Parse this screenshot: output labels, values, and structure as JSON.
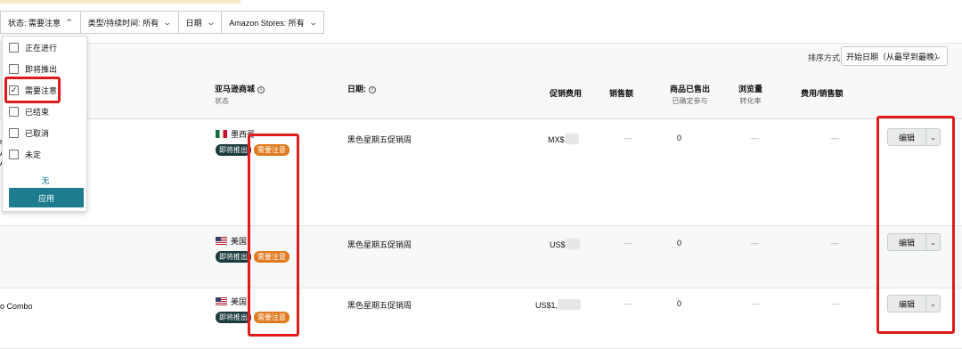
{
  "filters": [
    {
      "label": "状态: 需要注意",
      "chevron": "chevron-up"
    },
    {
      "label": "类型/持续时间: 所有",
      "chevron": "chevron-down"
    },
    {
      "label": "日期",
      "chevron": "chevron-down"
    },
    {
      "label": "Amazon Stores: 所有",
      "chevron": "chevron-down"
    }
  ],
  "status_dropdown": {
    "options": [
      {
        "label": "正在进行",
        "checked": false
      },
      {
        "label": "即将推出",
        "checked": false
      },
      {
        "label": "需要注意",
        "checked": true
      },
      {
        "label": "已结束",
        "checked": false
      },
      {
        "label": "已取消",
        "checked": false
      },
      {
        "label": "未定",
        "checked": false
      }
    ],
    "none_label": "无",
    "apply_label": "应用"
  },
  "sort": {
    "label": "排序方式",
    "value": "开始日期（从最早到最晚）"
  },
  "columns": {
    "store": "亚马逊商城",
    "store_sub": "状态",
    "date": "日期:",
    "promo_fee": "促销费用",
    "sales": "销售额",
    "units_sold": "商品已售出",
    "units_sub": "已确定参与",
    "views": "浏览量",
    "views_sub": "转化率",
    "fee_ratio": "费用/销售额"
  },
  "rows": [
    {
      "country": "墨西哥",
      "flag": "mx",
      "badges": [
        "即将推出",
        "需要注意"
      ],
      "date": "黑色星期五促销周",
      "promo_fee": "MX$",
      "sales": "—",
      "units": "0",
      "views": "—",
      "fee_ratio": "—",
      "edit": "编辑"
    },
    {
      "country": "美国",
      "flag": "us",
      "badges": [
        "即将推出",
        "需要注意"
      ],
      "date": "黑色星期五促销周",
      "promo_fee": "US$",
      "sales": "—",
      "units": "0",
      "views": "—",
      "fee_ratio": "—",
      "edit": "编辑"
    },
    {
      "country": "美国",
      "flag": "us",
      "badges": [
        "即将推出",
        "需要注意"
      ],
      "date": "黑色星期五促销周",
      "promo_fee": "US$1,",
      "sales": "—",
      "units": "0",
      "views": "—",
      "fee_ratio": "—",
      "edit": "编辑"
    }
  ],
  "left_fragments": {
    "row1_a": "m",
    "row1_b": "A",
    "row1_c": "A",
    "row3": "o Combo"
  },
  "colors": {
    "attention": "#e07a1f",
    "upcoming": "#1c3b3e",
    "apply": "#1d7d8e",
    "highlight": "#e11b1b"
  }
}
